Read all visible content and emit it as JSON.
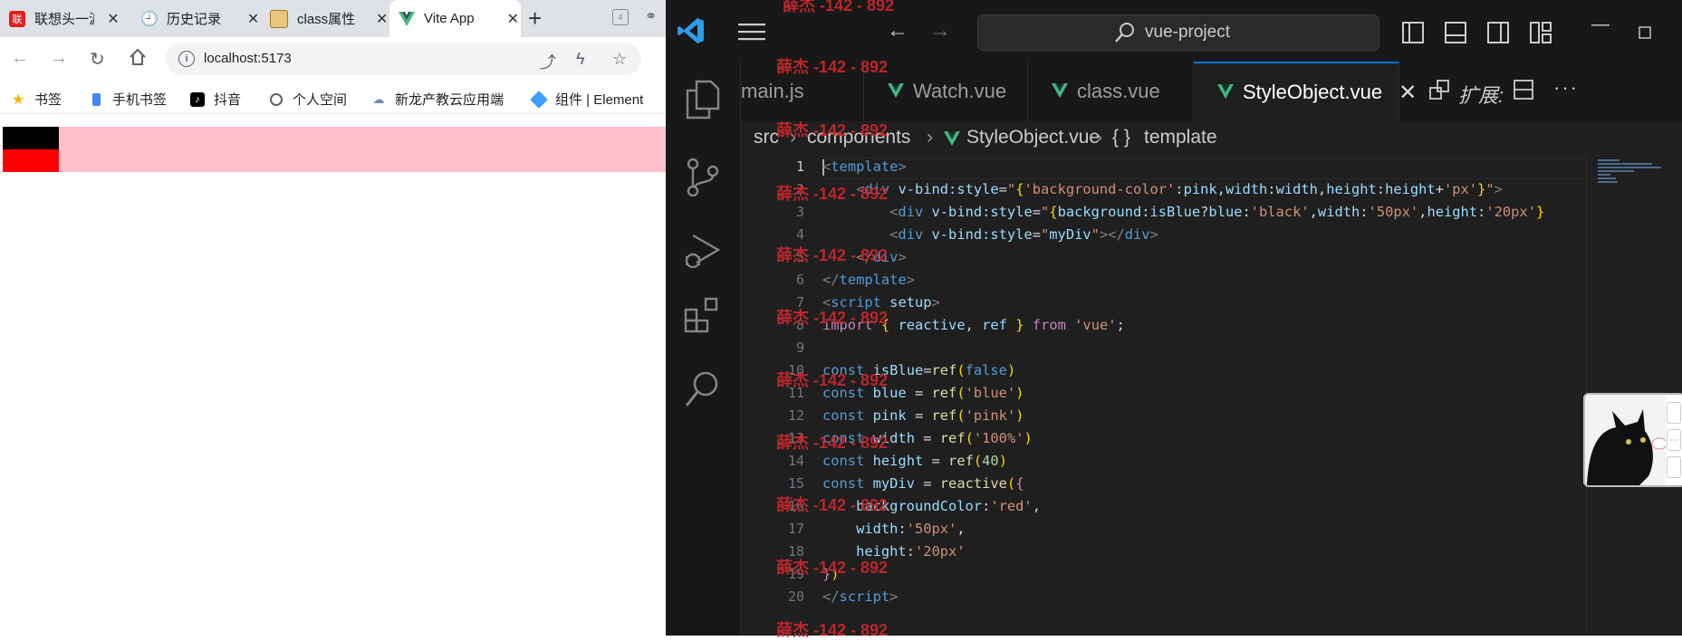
{
  "browser": {
    "tabs": [
      {
        "label": "联想头一波",
        "active": false
      },
      {
        "label": "历史记录",
        "active": false
      },
      {
        "label": "class属性",
        "active": false
      },
      {
        "label": "Vite App",
        "active": true
      }
    ],
    "address": "localhost:5173",
    "bookmarks": [
      {
        "label": "书签"
      },
      {
        "label": "手机书签"
      },
      {
        "label": "抖音"
      },
      {
        "label": "个人空间"
      },
      {
        "label": "新龙产教云应用端"
      },
      {
        "label": "组件 | Element"
      }
    ],
    "colors": {
      "pink": "#ffc0cb",
      "black": "#000000",
      "red": "#ff0000"
    }
  },
  "vscode": {
    "search": "vue-project",
    "tabs": [
      {
        "label": "main.js"
      },
      {
        "label": "Watch.vue"
      },
      {
        "label": "class.vue"
      },
      {
        "label": "StyleObject.vue",
        "active": true
      }
    ],
    "tab_extension_label": "扩展:",
    "breadcrumb": [
      "src",
      "components",
      "StyleObject.vue",
      "template"
    ],
    "line_numbers": [
      "1",
      "2",
      "3",
      "4",
      "5",
      "6",
      "7",
      "8",
      "9",
      "10",
      "11",
      "12",
      "13",
      "14",
      "15",
      "16",
      "17",
      "18",
      "19",
      "20"
    ]
  },
  "watermark": "薛杰 -142 - 892"
}
